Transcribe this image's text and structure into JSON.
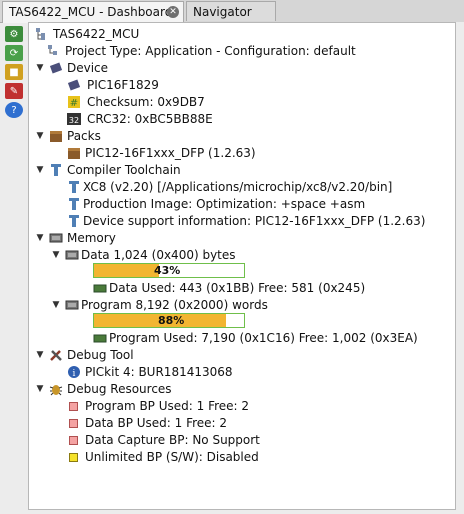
{
  "tabs": [
    {
      "label": "TAS6422_MCU - Dashboard",
      "closable": true,
      "active": true
    },
    {
      "label": "Navigator",
      "active": false
    }
  ],
  "toolbar_icons": [
    "settings-icon",
    "refresh-icon",
    "memory-icon",
    "pdf-icon",
    "help-icon"
  ],
  "tree": {
    "root": "TAS6422_MCU",
    "project_type": "Project Type: Application - Configuration: default",
    "device": {
      "label": "Device",
      "name": "PIC16F1829",
      "checksum": "Checksum: 0x9DB7",
      "crc": "CRC32: 0xBC5BB88E"
    },
    "packs": {
      "label": "Packs",
      "item": "PIC12-16F1xxx_DFP (1.2.63)"
    },
    "compiler": {
      "label": "Compiler Toolchain",
      "version": "XC8 (v2.20) [/Applications/microchip/xc8/v2.20/bin]",
      "production": "Production Image: Optimization: +space +asm",
      "support": "Device support information: PIC12-16F1xxx_DFP (1.2.63)"
    },
    "memory": {
      "label": "Memory",
      "data": {
        "label": "Data 1,024 (0x400) bytes",
        "percent": 43,
        "percent_label": "43%",
        "used": "Data Used: 443 (0x1BB) Free: 581 (0x245)"
      },
      "program": {
        "label": "Program 8,192 (0x2000) words",
        "percent": 88,
        "percent_label": "88%",
        "used": "Program Used: 7,190 (0x1C16) Free: 1,002 (0x3EA)"
      }
    },
    "debug_tool": {
      "label": "Debug Tool",
      "item": "PICkit 4: BUR181413068"
    },
    "debug_resources": {
      "label": "Debug Resources",
      "items": [
        {
          "label": "Program BP Used: 1  Free: 2",
          "color": "#f4a3a3"
        },
        {
          "label": "Data BP Used: 1  Free: 2",
          "color": "#f4a3a3"
        },
        {
          "label": "Data Capture BP: No Support",
          "color": "#f4a3a3"
        },
        {
          "label": "Unlimited BP (S/W): Disabled",
          "color": "#f5e22a"
        }
      ]
    }
  }
}
